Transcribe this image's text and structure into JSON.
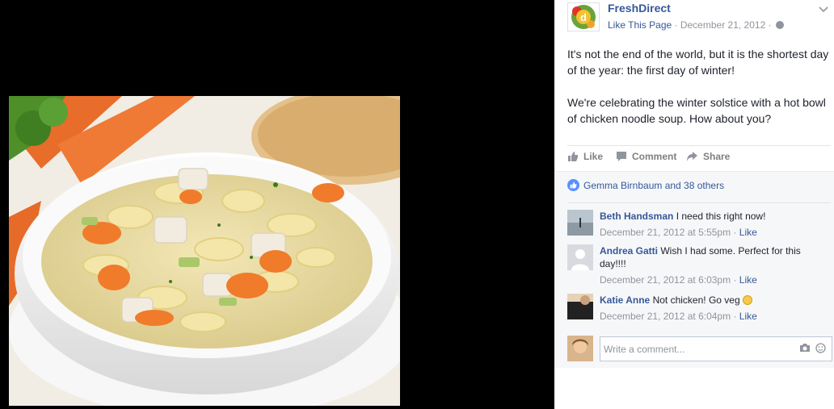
{
  "post": {
    "page_name": "FreshDirect",
    "like_page_label": "Like This Page",
    "meta_sep": " · ",
    "date": "December 21, 2012",
    "paragraphs": [
      "It's not the end of the world, but it is the shortest day of the year: the first day of winter!",
      "We're celebrating the winter solstice with a hot bowl of chicken noodle soup. How about you?"
    ]
  },
  "actions": {
    "like": "Like",
    "comment": "Comment",
    "share": "Share"
  },
  "likes_summary": "Gemma Birnbaum and 38 others",
  "comments": [
    {
      "name": "Beth Handsman",
      "text": "I need this right now!",
      "time": "December 21, 2012 at 5:55pm",
      "like": "Like"
    },
    {
      "name": "Andrea Gatti",
      "text": "Wish I had some. Perfect for this day!!!!",
      "time": "December 21, 2012 at 6:03pm",
      "like": "Like"
    },
    {
      "name": "Katie Anne",
      "text": "Not chicken! Go veg",
      "time": "December 21, 2012 at 6:04pm",
      "like": "Like"
    }
  ],
  "composer": {
    "placeholder": "Write a comment..."
  },
  "colors": {
    "link": "#365899",
    "brand_green": "#5a9a2a",
    "like_blue": "#5890ff"
  }
}
